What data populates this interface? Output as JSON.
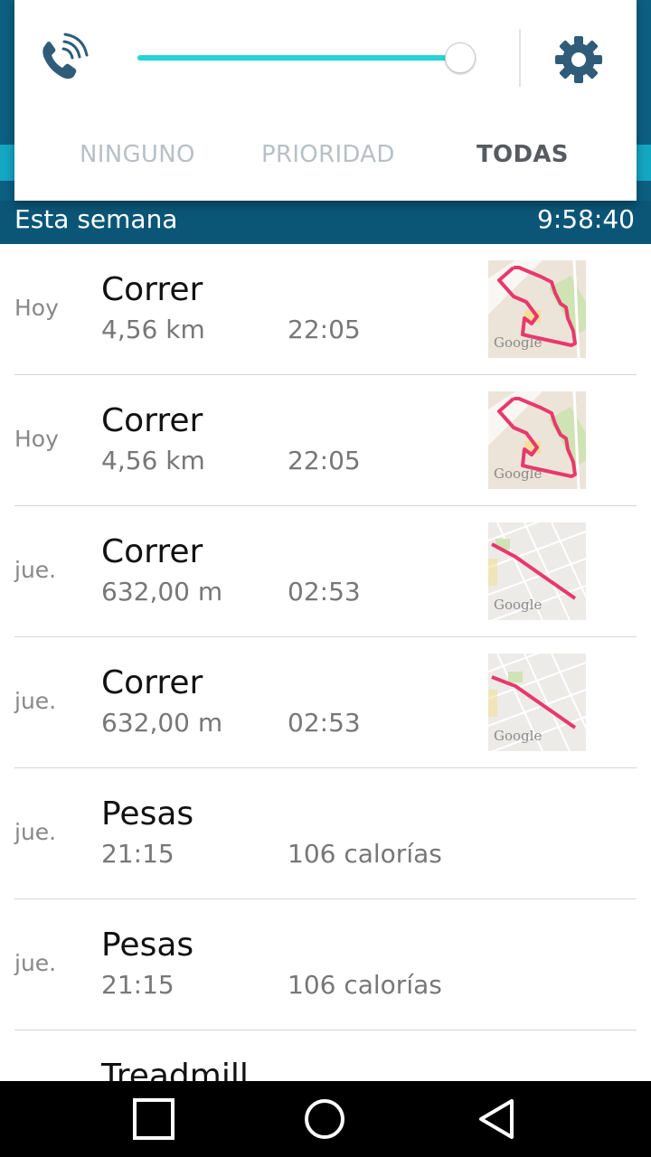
{
  "volume_panel": {
    "level": 1.0,
    "modes": [
      "NINGUNO",
      "PRIORIDAD",
      "TODAS"
    ],
    "selected_mode": "TODAS",
    "icons": {
      "left": "phone-volume-icon",
      "right": "gear-icon"
    },
    "accent_color": "#26d4d6"
  },
  "week_header": {
    "label": "Esta semana",
    "time": "9:58:40"
  },
  "activities": [
    {
      "day": "Hoy",
      "title": "Correr",
      "metric1": "4,56 km",
      "metric2": "22:05",
      "map": "route-loop"
    },
    {
      "day": "Hoy",
      "title": "Correr",
      "metric1": "4,56 km",
      "metric2": "22:05",
      "map": "route-loop"
    },
    {
      "day": "jue.",
      "title": "Correr",
      "metric1": "632,00 m",
      "metric2": "02:53",
      "map": "route-line"
    },
    {
      "day": "jue.",
      "title": "Correr",
      "metric1": "632,00 m",
      "metric2": "02:53",
      "map": "route-line"
    },
    {
      "day": "jue.",
      "title": "Pesas",
      "metric1": "21:15",
      "metric2": "106 calorías"
    },
    {
      "day": "jue.",
      "title": "Pesas",
      "metric1": "21:15",
      "metric2": "106 calorías"
    },
    {
      "title": "Treadmill"
    }
  ],
  "map_watermark": "Google",
  "colors": {
    "route": "#e8386d",
    "header": "#0b5677"
  },
  "navbar": {
    "buttons": [
      "recents-icon",
      "home-icon",
      "back-icon"
    ]
  }
}
